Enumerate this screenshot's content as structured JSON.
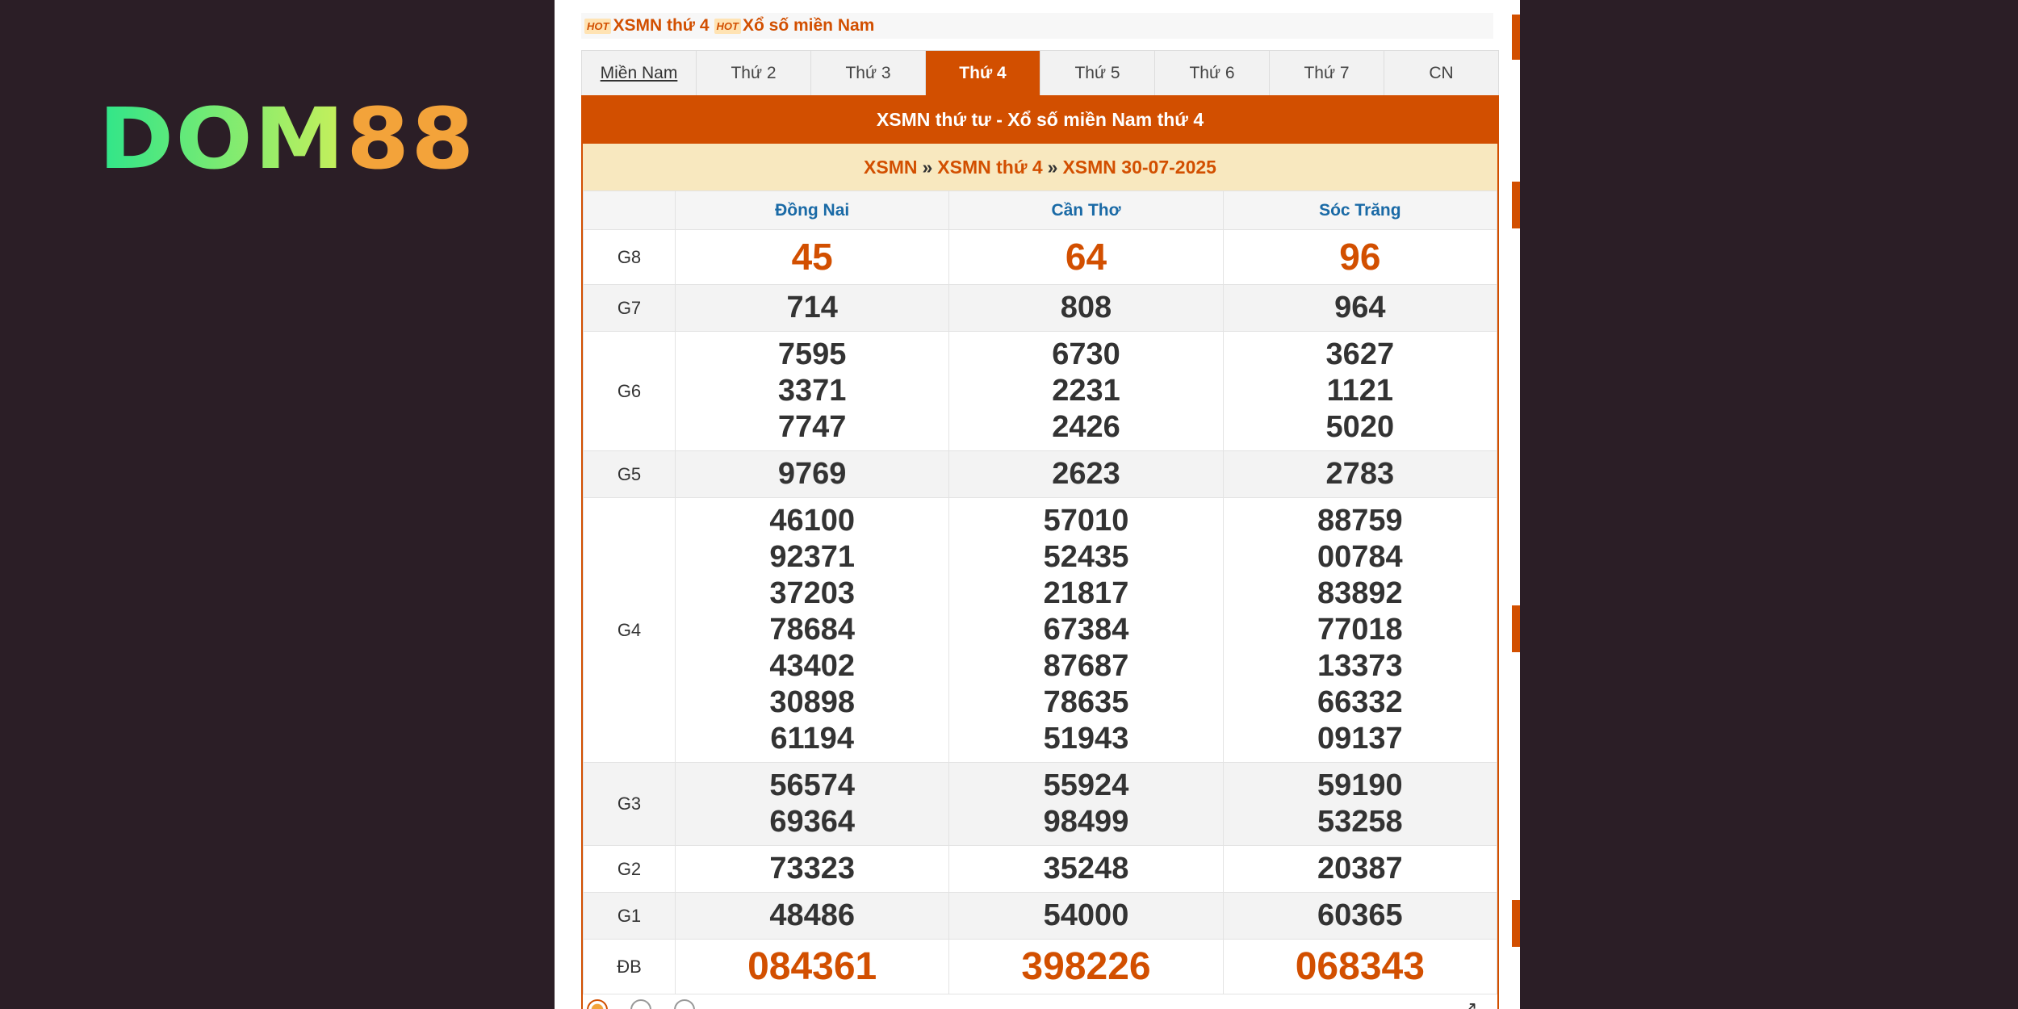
{
  "logo": {
    "part1": "DOM",
    "part2": "88"
  },
  "hot_bar": {
    "badge": "HOT",
    "links": [
      "XSMN thứ 4",
      "Xổ số miền Nam"
    ]
  },
  "tabs": [
    {
      "label": "Miền Nam"
    },
    {
      "label": "Thứ 2"
    },
    {
      "label": "Thứ 3"
    },
    {
      "label": "Thứ 4"
    },
    {
      "label": "Thứ 5"
    },
    {
      "label": "Thứ 6"
    },
    {
      "label": "Thứ 7"
    },
    {
      "label": "CN"
    }
  ],
  "title": "XSMN thứ tư - Xổ số miền Nam thứ 4",
  "breadcrumb": {
    "items": [
      "XSMN",
      "XSMN thứ 4",
      "XSMN 30-07-2025"
    ],
    "separator": "»"
  },
  "provinces": [
    "Đồng Nai",
    "Cần Thơ",
    "Sóc Trăng"
  ],
  "prizes": [
    {
      "label": "G8",
      "values": [
        [
          "45"
        ],
        [
          "64"
        ],
        [
          "96"
        ]
      ]
    },
    {
      "label": "G7",
      "values": [
        [
          "714"
        ],
        [
          "808"
        ],
        [
          "964"
        ]
      ]
    },
    {
      "label": "G6",
      "values": [
        [
          "7595",
          "3371",
          "7747"
        ],
        [
          "6730",
          "2231",
          "2426"
        ],
        [
          "3627",
          "1121",
          "5020"
        ]
      ]
    },
    {
      "label": "G5",
      "values": [
        [
          "9769"
        ],
        [
          "2623"
        ],
        [
          "2783"
        ]
      ]
    },
    {
      "label": "G4",
      "values": [
        [
          "46100",
          "92371",
          "37203",
          "78684",
          "43402",
          "30898",
          "61194"
        ],
        [
          "57010",
          "52435",
          "21817",
          "67384",
          "87687",
          "78635",
          "51943"
        ],
        [
          "88759",
          "00784",
          "83892",
          "77018",
          "13373",
          "66332",
          "09137"
        ]
      ]
    },
    {
      "label": "G3",
      "values": [
        [
          "56574",
          "69364"
        ],
        [
          "55924",
          "98499"
        ],
        [
          "59190",
          "53258"
        ]
      ]
    },
    {
      "label": "G2",
      "values": [
        [
          "73323"
        ],
        [
          "35248"
        ],
        [
          "20387"
        ]
      ]
    },
    {
      "label": "G1",
      "values": [
        [
          "48486"
        ],
        [
          "54000"
        ],
        [
          "60365"
        ]
      ]
    },
    {
      "label": "ĐB",
      "values": [
        [
          "084361"
        ],
        [
          "398226"
        ],
        [
          "068343"
        ]
      ]
    }
  ],
  "colors": {
    "accent": "#d24f00",
    "header_text": "#1a6aa6",
    "crumb_bg": "#f8e8bf"
  }
}
